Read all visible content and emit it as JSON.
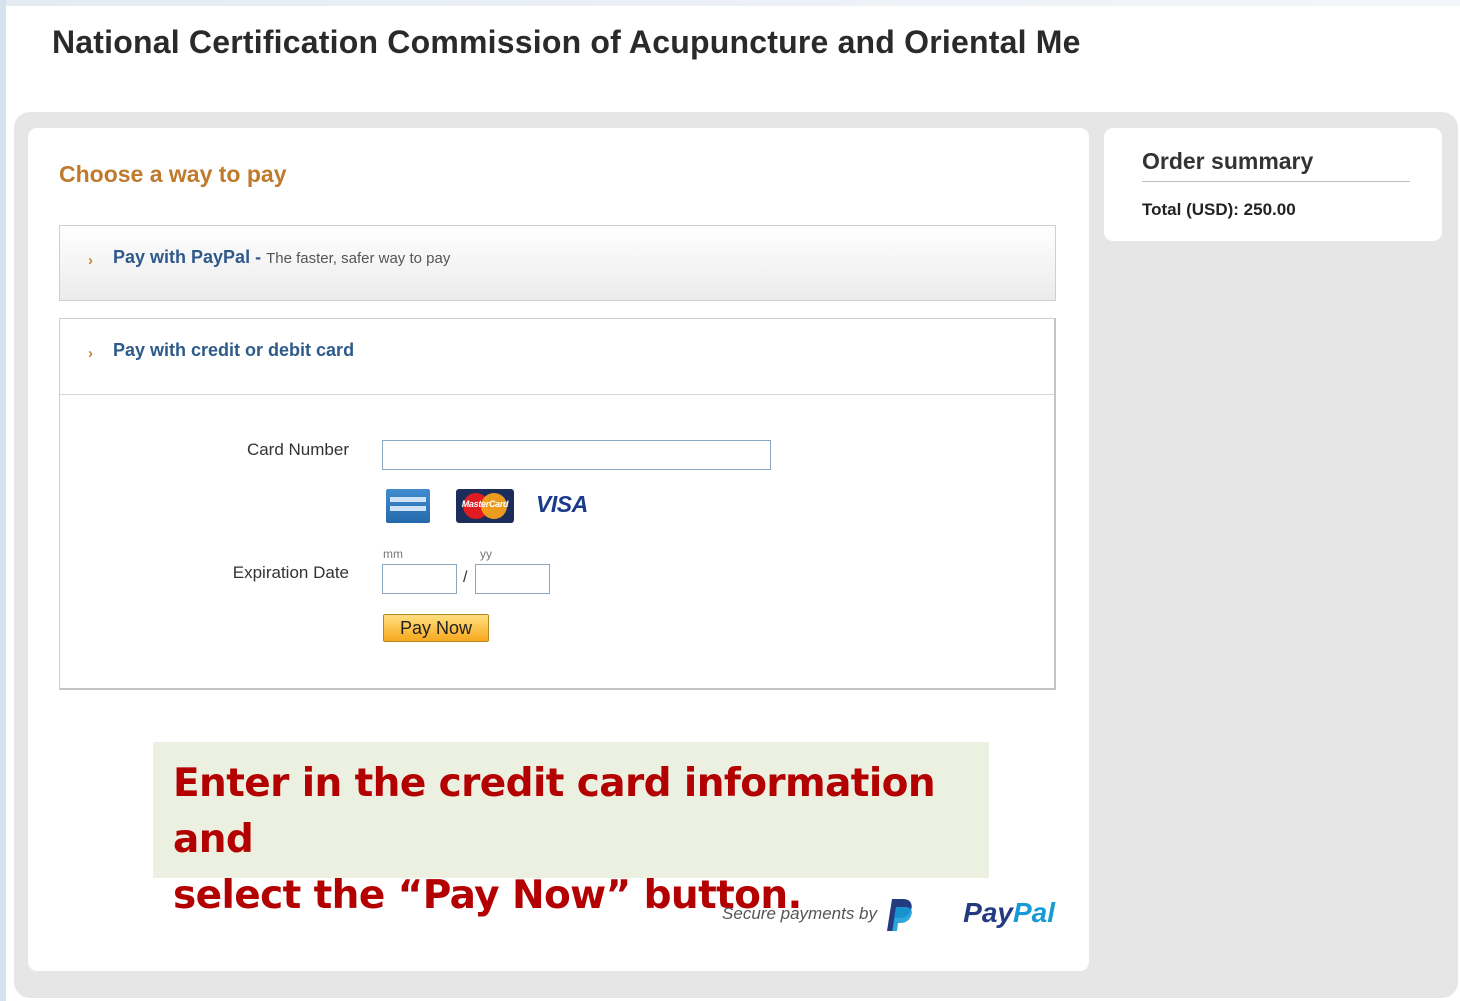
{
  "header": {
    "title": "National Certification Commission of Acupuncture and Oriental Me"
  },
  "payment": {
    "heading": "Choose a way to pay",
    "paypal_option": {
      "label": "Pay with PayPal",
      "separator": " - ",
      "tagline": "The faster, safer way to pay"
    },
    "card_option": {
      "label": "Pay with credit or debit card"
    },
    "card_number_label": "Card Number",
    "card_number_value": "",
    "expiration_label": "Expiration Date",
    "mm_hint": "mm",
    "yy_hint": "yy",
    "mm_value": "",
    "yy_value": "",
    "slash": "/",
    "pay_now_label": "Pay Now",
    "brands": {
      "visa": "VISA",
      "mastercard": "MasterCard"
    }
  },
  "summary": {
    "title": "Order summary",
    "total": "Total (USD): 250.00"
  },
  "callout": {
    "line1": "Enter in the credit card information and",
    "line2": "select the “Pay Now” button."
  },
  "footer": {
    "secure_text": "Secure payments by",
    "pay": "Pay",
    "pal": "Pal"
  },
  "icons": {
    "chevron": "chevron-right-icon",
    "paypal_mark": "paypal-p-icon"
  },
  "colors": {
    "heading_orange": "#c07a2c",
    "link_blue": "#2e5a8a",
    "callout_red": "#b30000",
    "callout_bg": "#ebf0e0",
    "button_gold": "#f7a91e"
  }
}
